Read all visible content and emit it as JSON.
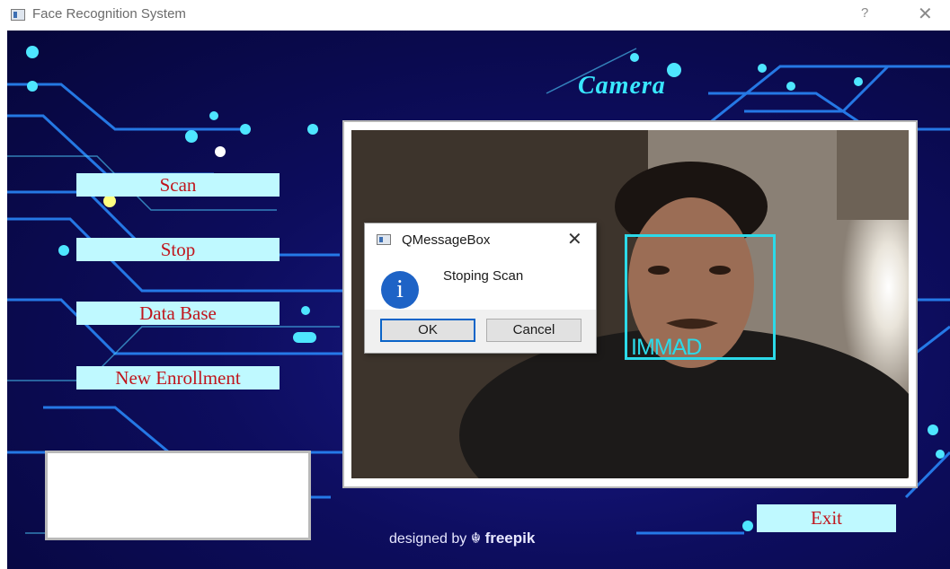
{
  "window": {
    "title": "Face Recognition System",
    "help_glyph": "?",
    "close_glyph": "✕"
  },
  "camera": {
    "title": "Camera",
    "detected_name": "IMMAD"
  },
  "sidebar": {
    "buttons": [
      {
        "label": "Scan"
      },
      {
        "label": "Stop"
      },
      {
        "label": "Data Base"
      },
      {
        "label": "New Enrollment"
      }
    ]
  },
  "exit_label": "Exit",
  "info_box_text": "",
  "footer": {
    "designed_by": "designed by",
    "brand": "freepik"
  },
  "messagebox": {
    "title": "QMessageBox",
    "message": "Stoping Scan",
    "close_glyph": "✕",
    "ok_label": "OK",
    "cancel_label": "Cancel",
    "info_glyph": "i"
  },
  "colors": {
    "button_bg": "#bff9ff",
    "button_text": "#c0161d",
    "camera_title": "#39e7ff",
    "face_box": "#2cd9e8"
  }
}
